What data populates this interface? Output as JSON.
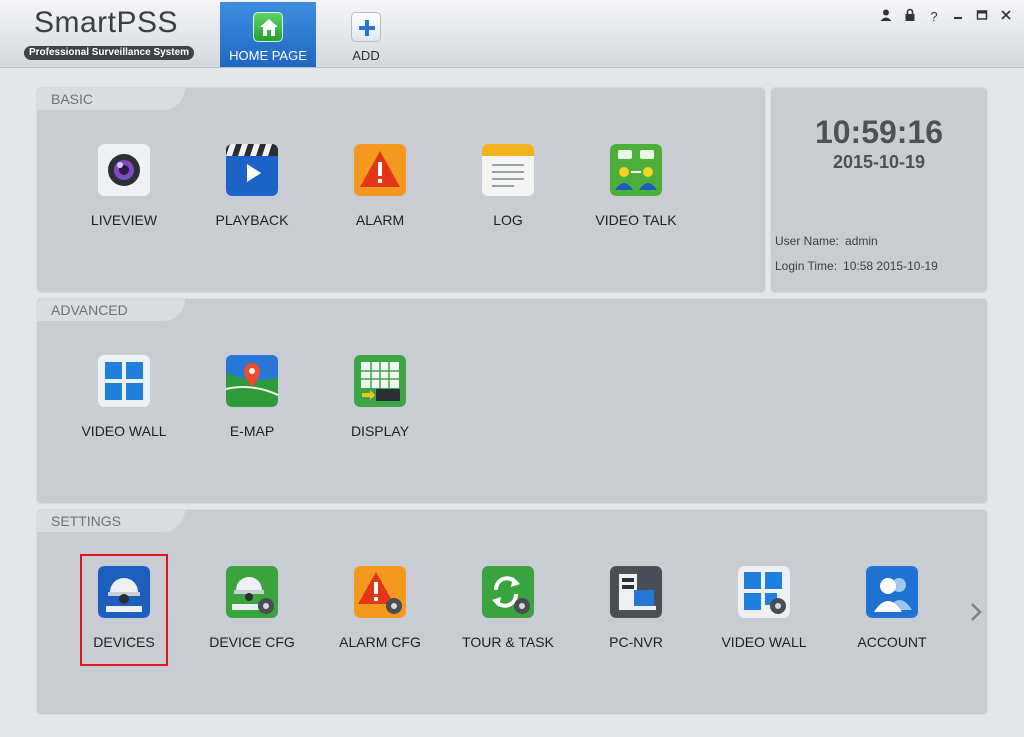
{
  "app": {
    "name": "SmartPSS",
    "subtitle": "Professional Surveillance System"
  },
  "tabs": [
    {
      "label": "HOME PAGE",
      "icon": "home-icon",
      "active": true
    },
    {
      "label": "ADD",
      "icon": "plus-icon",
      "active": false
    }
  ],
  "window_controls": [
    "user-icon",
    "lock-icon",
    "help-icon",
    "minimize-icon",
    "maximize-icon",
    "close-icon"
  ],
  "sections": {
    "basic": {
      "title": "BASIC",
      "items": [
        {
          "label": "LIVEVIEW",
          "icon": "camera-lens-icon"
        },
        {
          "label": "PLAYBACK",
          "icon": "clapperboard-play-icon"
        },
        {
          "label": "ALARM",
          "icon": "alarm-warning-icon"
        },
        {
          "label": "LOG",
          "icon": "log-notepad-icon"
        },
        {
          "label": "VIDEO TALK",
          "icon": "video-talk-icon"
        }
      ]
    },
    "advanced": {
      "title": "ADVANCED",
      "items": [
        {
          "label": "VIDEO WALL",
          "icon": "video-wall-icon"
        },
        {
          "label": "E-MAP",
          "icon": "map-pin-icon"
        },
        {
          "label": "DISPLAY",
          "icon": "display-grid-icon"
        }
      ]
    },
    "settings": {
      "title": "SETTINGS",
      "items": [
        {
          "label": "DEVICES",
          "icon": "dome-camera-icon",
          "selected": true
        },
        {
          "label": "DEVICE CFG",
          "icon": "dome-camera-gear-icon"
        },
        {
          "label": "ALARM CFG",
          "icon": "alarm-gear-icon"
        },
        {
          "label": "TOUR & TASK",
          "icon": "refresh-gear-icon"
        },
        {
          "label": "PC-NVR",
          "icon": "pc-nvr-icon"
        },
        {
          "label": "VIDEO WALL",
          "icon": "video-wall-gear-icon"
        },
        {
          "label": "ACCOUNT",
          "icon": "account-users-icon"
        }
      ]
    }
  },
  "info": {
    "time": "10:59:16",
    "date": "2015-10-19",
    "user_name_label": "User Name:",
    "user_name": "admin",
    "login_time_label": "Login Time:",
    "login_time": "10:58 2015-10-19"
  },
  "colors": {
    "accent": "#2a75d2",
    "selection_border": "#e0141d",
    "panel": "#c9ccd3"
  }
}
